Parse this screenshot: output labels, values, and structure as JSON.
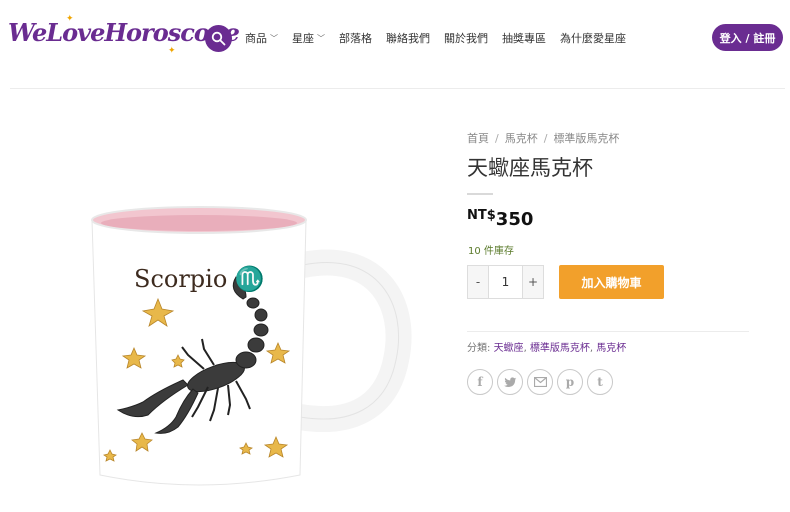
{
  "header": {
    "logo_text": "WeLoveHoroscope",
    "nav": [
      {
        "label": "商品",
        "has_dropdown": true
      },
      {
        "label": "星座",
        "has_dropdown": true
      },
      {
        "label": "部落格",
        "has_dropdown": false
      },
      {
        "label": "聯絡我們",
        "has_dropdown": false
      },
      {
        "label": "關於我們",
        "has_dropdown": false
      },
      {
        "label": "抽獎專區",
        "has_dropdown": false
      },
      {
        "label": "為什麼愛星座",
        "has_dropdown": false
      }
    ],
    "login_label": "登入 / 註冊",
    "search_icon": "search-icon"
  },
  "product": {
    "breadcrumb": [
      "首頁",
      "馬克杯",
      "標準版馬克杯"
    ],
    "title": "天蠍座馬克杯",
    "price_currency": "NT$",
    "price_amount": "350",
    "stock": "10 件庫存",
    "quantity": "1",
    "qty_minus": "-",
    "qty_plus": "+",
    "add_to_cart": "加入購物車",
    "category_label": "分類:",
    "categories": [
      "天蠍座",
      "標準版馬克杯",
      "馬克杯"
    ],
    "image_caption": "Scorpio ♏",
    "share_icons": [
      "facebook-icon",
      "twitter-icon",
      "email-icon",
      "pinterest-icon",
      "tumblr-icon"
    ]
  },
  "colors": {
    "brand": "#6a2c91",
    "accent": "#f2a02b",
    "stock": "#5a7a2a",
    "mug_inner": "#f2c6cf"
  }
}
